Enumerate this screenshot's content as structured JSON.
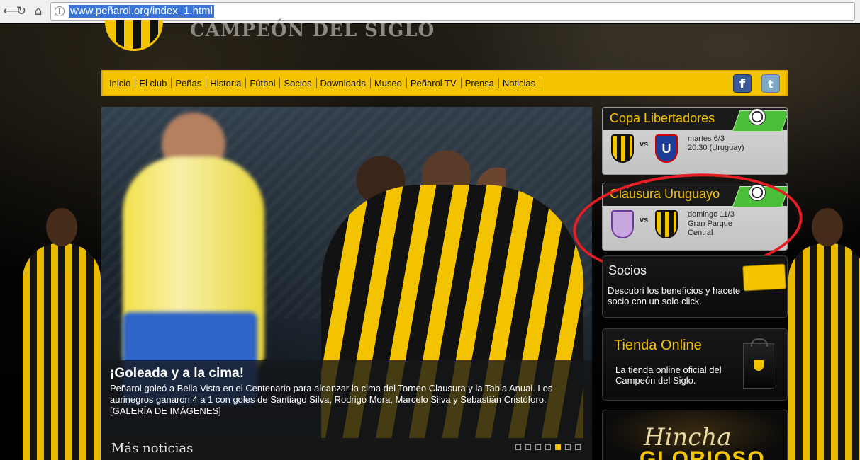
{
  "browser": {
    "url": "www.peñarol.org/index_1.html"
  },
  "site": {
    "title": "CAMPEÓN DEL SIGLO"
  },
  "menu": [
    "Inicio",
    "El club",
    "Peñas",
    "Historia",
    "Fútbol",
    "Socios",
    "Downloads",
    "Museo",
    "Peñarol TV",
    "Prensa",
    "Noticias"
  ],
  "social": {
    "facebook": "f",
    "twitter": "t"
  },
  "hero": {
    "title": "¡Goleada y a la cima!",
    "text": "Peñarol goleó a Bella Vista en el Centenario para alcanzar la cima del Torneo Clausura y la Tabla Anual. Los aurinegros ganaron 4 a 1 con goles de Santiago Silva, Rodrigo Mora, Marcelo Silva y Sebastián Cristóforo. [GALERÍA DE IMÁGENES]",
    "more_news": "Más noticias",
    "slide_count": 7,
    "active_slide": 5
  },
  "matches": [
    {
      "competition": "Copa Libertadores",
      "vs": "vs",
      "info_line1": "martes 6/3",
      "info_line2": "20:30 (Uruguay)",
      "info_line3": ""
    },
    {
      "competition": "Clausura Uruguayo",
      "vs": "vs",
      "info_line1": "domingo 11/3",
      "info_line2": "Gran Parque",
      "info_line3": "Central"
    }
  ],
  "socios": {
    "title": "Socios",
    "text": "Descubrí los beneficios y hacete socio con un solo click."
  },
  "tienda": {
    "title": "Tienda Online",
    "text": "La tienda online oficial del Campeón del Siglo."
  },
  "hincha": {
    "line1": "Hincha",
    "line2": "GLORIOSO"
  },
  "colors": {
    "accent": "#f5c400",
    "annotation": "#e51d24"
  }
}
